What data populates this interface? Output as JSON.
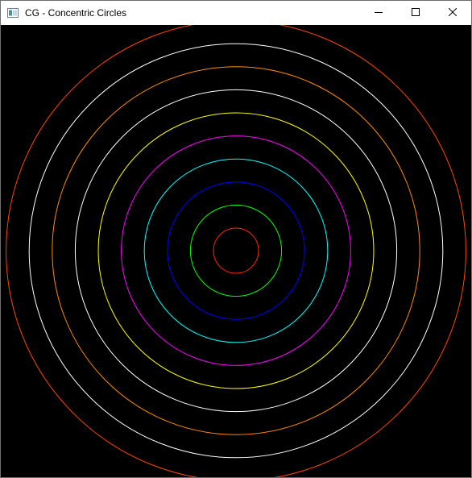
{
  "window": {
    "title": "CG - Concentric Circles",
    "app_icon": "window-app-icon",
    "controls": {
      "minimize_icon": "minimize-icon",
      "maximize_icon": "maximize-icon",
      "close_icon": "close-icon"
    }
  },
  "canvas": {
    "background": "#000000",
    "circles": [
      {
        "color": "#ff2a00"
      },
      {
        "color": "#00ff00"
      },
      {
        "color": "#0000ff"
      },
      {
        "color": "#00ffff"
      },
      {
        "color": "#ff00ff"
      },
      {
        "color": "#ffff00"
      },
      {
        "color": "#ffffff"
      },
      {
        "color": "#ff8c00"
      },
      {
        "color": "#ffffff"
      },
      {
        "color": "#ff4500"
      }
    ]
  }
}
